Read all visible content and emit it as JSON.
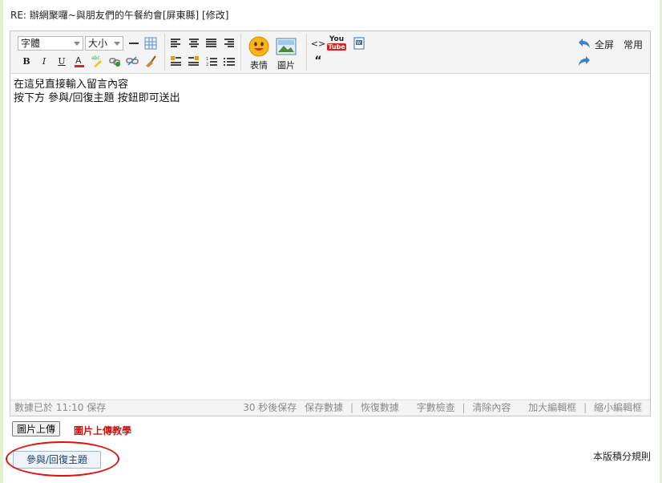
{
  "subject": "RE: 辦網聚囉~與朋友們的午餐約會[屏東縣] [修改]",
  "toolbar": {
    "font_select": "字體",
    "size_select": "大小",
    "emoticon_label": "表情",
    "image_label": "圖片",
    "youtube_top": "You",
    "youtube_bottom": "Tube",
    "quote_glyph": "“",
    "code_glyph": "<>",
    "fullscreen_label": "全屏",
    "common_label": "常用"
  },
  "content_lines": [
    "在這兒直接輸入留言內容",
    "按下方  參與/回復主題  按鈕即可送出"
  ],
  "status": {
    "saved": "數據已於  11:10  保存",
    "autosave": "30 秒後保存",
    "save_data": "保存數據",
    "restore": "恢復數據",
    "word_check": "字數檢查",
    "clear": "清除內容",
    "enlarge": "加大編輯框",
    "shrink": "縮小編輯框"
  },
  "upload_button": "圖片上傳",
  "upload_help": "圖片上傳教學",
  "reply_button": "參與/回復主題",
  "rules_link": "本版積分規則",
  "colors": {
    "frame": "#e3f2c9",
    "highlight": "#e01010",
    "help_text": "#d01010"
  }
}
